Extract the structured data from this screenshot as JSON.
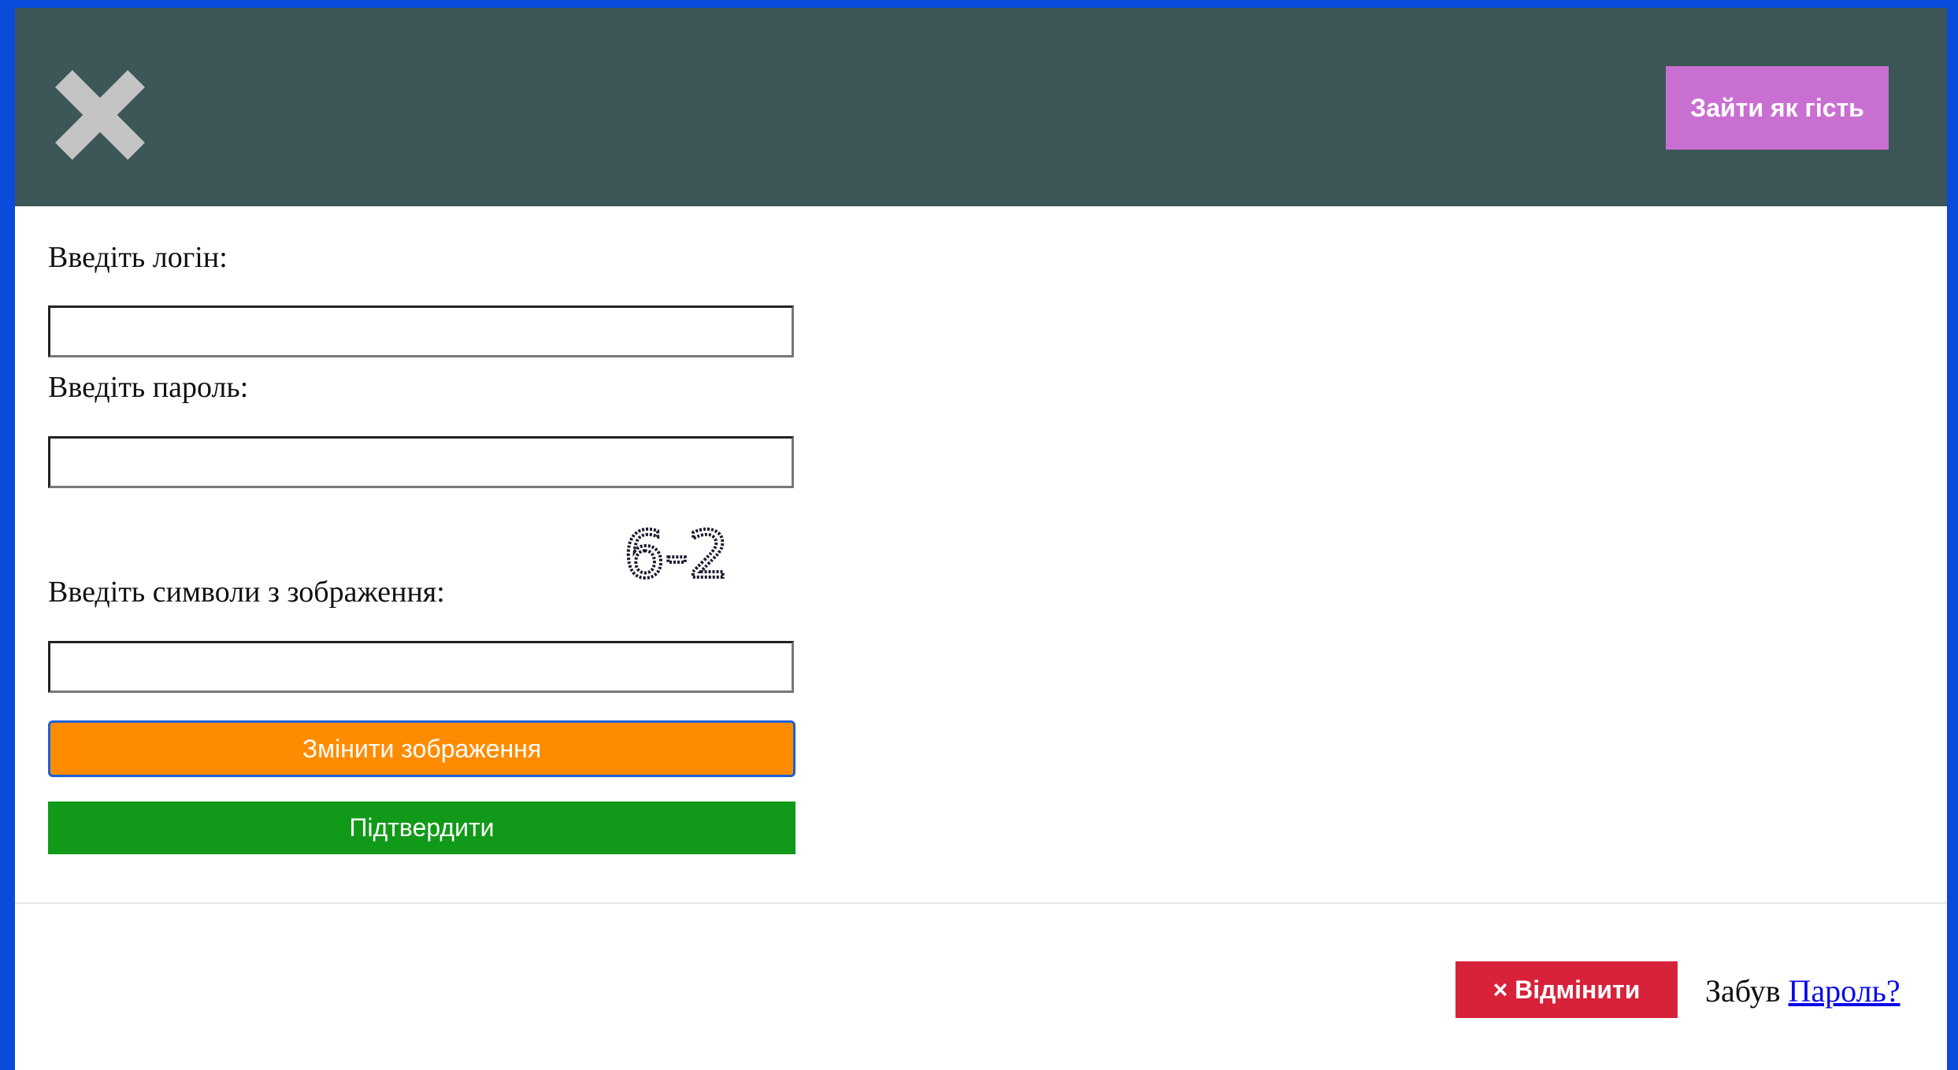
{
  "header": {
    "close_icon": "close-x-icon",
    "guest_button": "Зайти як гість",
    "background": "#3d5657",
    "guest_color": "#c96fd2"
  },
  "form": {
    "login_label": "Введіть логін:",
    "login_value": "",
    "password_label": "Введіть пароль:",
    "password_value": "",
    "captcha_text": "6-2",
    "captcha_label": "Введіть символи з зображення:",
    "captcha_value": "",
    "refresh_button": "Змінити зображення",
    "refresh_color": "#ff8c00",
    "confirm_button": "Підтвердити",
    "confirm_color": "#119a19"
  },
  "footer": {
    "cancel_button": "× Відмінити",
    "cancel_color": "#d8223a",
    "forgot_text": "Забув",
    "forgot_link": "Пароль?"
  },
  "page": {
    "frame_color": "#0a4bdb"
  }
}
